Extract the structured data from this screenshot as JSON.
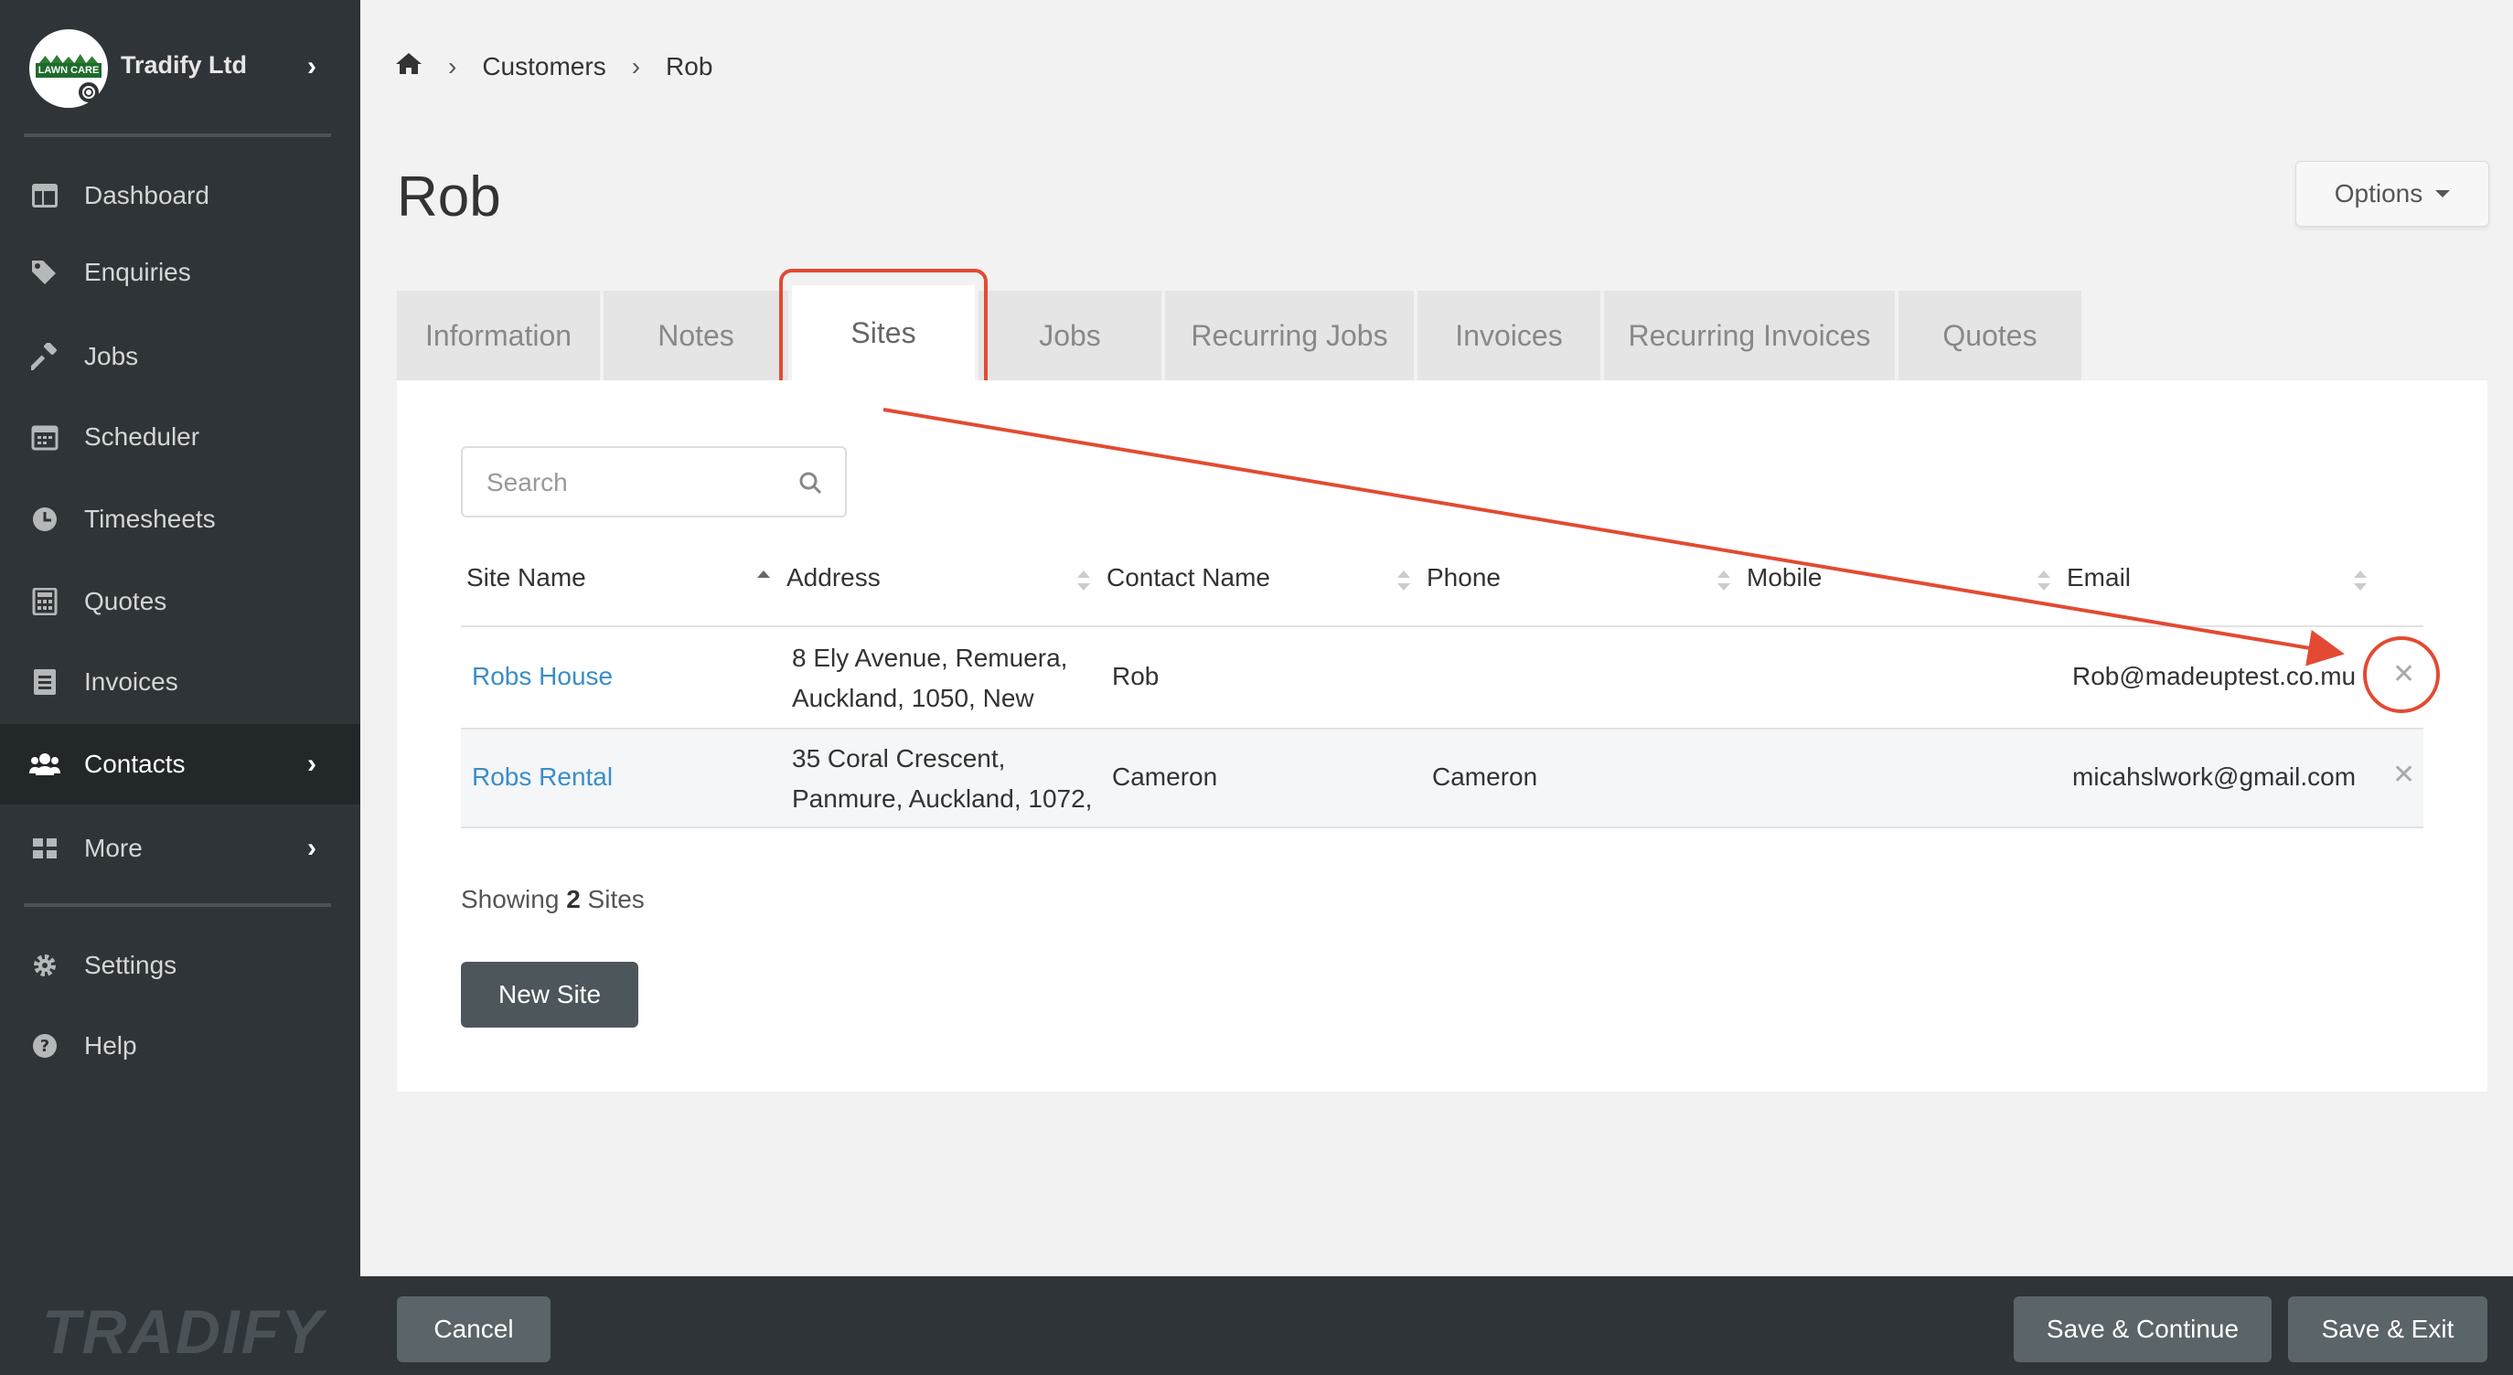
{
  "sidebar": {
    "company": "Tradify Ltd",
    "logo_text": "LAWN CARE",
    "items": [
      {
        "label": "Dashboard",
        "icon": "dashboard-icon"
      },
      {
        "label": "Enquiries",
        "icon": "tags-icon"
      },
      {
        "label": "Jobs",
        "icon": "hammer-icon"
      },
      {
        "label": "Scheduler",
        "icon": "calendar-icon"
      },
      {
        "label": "Timesheets",
        "icon": "clock-icon"
      },
      {
        "label": "Quotes",
        "icon": "calculator-icon"
      },
      {
        "label": "Invoices",
        "icon": "file-icon"
      },
      {
        "label": "Contacts",
        "icon": "users-icon"
      },
      {
        "label": "More",
        "icon": "grid-icon"
      },
      {
        "label": "Settings",
        "icon": "gear-icon"
      },
      {
        "label": "Help",
        "icon": "help-icon"
      }
    ],
    "brand": "TRADIFY"
  },
  "breadcrumb": {
    "items": [
      "Customers",
      "Rob"
    ]
  },
  "page": {
    "title": "Rob",
    "options_label": "Options"
  },
  "tabs": [
    {
      "label": "Information"
    },
    {
      "label": "Notes"
    },
    {
      "label": "Sites"
    },
    {
      "label": "Jobs"
    },
    {
      "label": "Recurring Jobs"
    },
    {
      "label": "Invoices"
    },
    {
      "label": "Recurring Invoices"
    },
    {
      "label": "Quotes"
    }
  ],
  "search": {
    "placeholder": "Search"
  },
  "table": {
    "headers": [
      "Site Name",
      "Address",
      "Contact Name",
      "Phone",
      "Mobile",
      "Email"
    ],
    "rows": [
      {
        "site": "Robs House",
        "address_line1": "8 Ely Avenue, Remuera,",
        "address_line2": "Auckland, 1050, New",
        "contact": "Rob",
        "phone": "",
        "mobile": "",
        "email": "Rob@madeuptest.co.mu"
      },
      {
        "site": "Robs Rental",
        "address_line1": "35 Coral Crescent,",
        "address_line2": "Panmure, Auckland, 1072,",
        "contact": "Cameron",
        "phone": "Cameron",
        "mobile": "",
        "email": "micahslwork@gmail.com"
      }
    ]
  },
  "showing": {
    "prefix": "Showing",
    "count": "2",
    "suffix": "Sites"
  },
  "buttons": {
    "new_site": "New Site",
    "cancel": "Cancel",
    "save_continue": "Save & Continue",
    "save_exit": "Save & Exit"
  },
  "colors": {
    "accent": "#3b8dc7",
    "annotation": "#e34a33",
    "sidebar": "#2e3437"
  }
}
